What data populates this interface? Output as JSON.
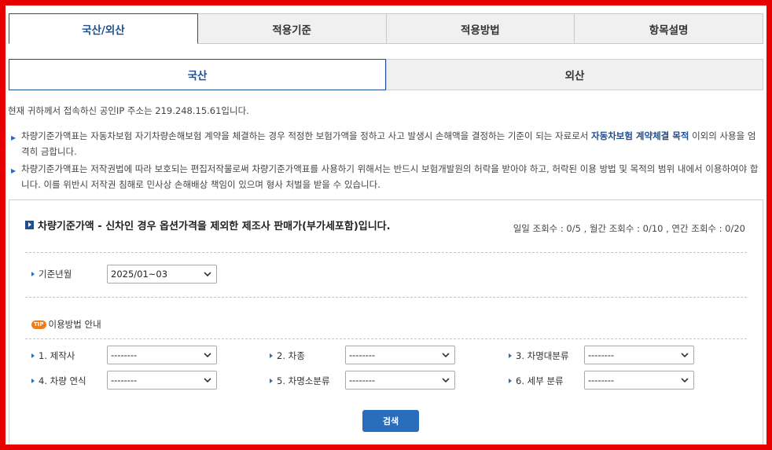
{
  "main_tabs": [
    "국산/외산",
    "적용기준",
    "적용방법",
    "항목설명"
  ],
  "sub_tabs": [
    "국산",
    "외산"
  ],
  "ip_notice": "현재 귀하께서 접속하신 공인IP 주소는 219.248.15.61입니다.",
  "notices": {
    "n1_pre": "차량기준가액표는 자동차보험 자기차량손해보험 계약을 체결하는 경우 적정한 보험가액을 정하고 사고 발생시 손해액을 결정하는 기준이 되는 자료로서 ",
    "n1_hl": "자동차보험 계약체결 목적",
    "n1_post": " 이외의 사용을 엄격히 금합니다.",
    "n2": "차량기준가액표는 저작권법에 따라 보호되는 편집저작물로써 차량기준가액표를 사용하기 위해서는 반드시 보험개발원의 허락을 받아야 하고, 허락된 이용 방법 및 목적의 범위 내에서 이용하여야 합니다. 이를 위반시 저작권 침해로 민사상 손해배상 책임이 있으며 형사 처벌을 받을 수 있습니다."
  },
  "panel": {
    "title": "차량기준가액 - 신차인 경우 옵션가격을 제외한 제조사 판매가(부가세포함)입니다.",
    "counts": "일일 조회수 : 0/5 , 월간 조회수 : 0/10 , 연간 조회수 : 0/20",
    "base_label": "기준년월",
    "base_value": "2025/01~03",
    "tip_badge": "TIP",
    "tip_label": "이용방법 안내",
    "fields": {
      "f1_label": "1. 제작사",
      "f1_value": "--------",
      "f2_label": "2. 차종",
      "f2_value": "--------",
      "f3_label": "3. 차명대분류",
      "f3_value": "--------",
      "f4_label": "4. 차량 연식",
      "f4_value": "--------",
      "f5_label": "5. 차명소분류",
      "f5_value": "--------",
      "f6_label": "6. 세부 분류",
      "f6_value": "--------"
    },
    "search_label": "검색"
  }
}
